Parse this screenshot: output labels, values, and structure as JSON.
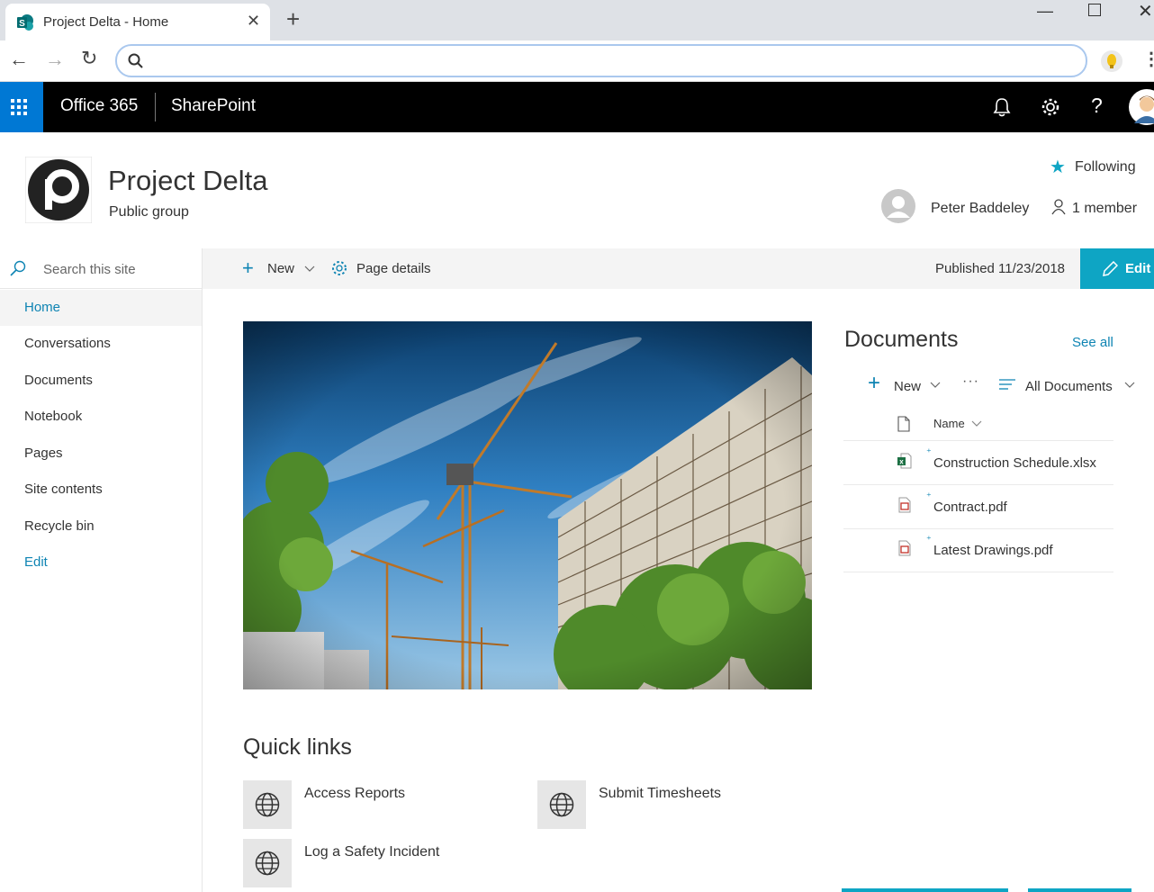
{
  "browser": {
    "tab_title": "Project Delta - Home",
    "new_tab": "+",
    "address": ""
  },
  "suite": {
    "app_name": "Office 365",
    "product": "SharePoint"
  },
  "site": {
    "title": "Project Delta",
    "subtitle": "Public group",
    "following": "Following",
    "owner": "Peter Baddeley",
    "members": "1 member"
  },
  "nav": {
    "search_placeholder": "Search this site",
    "items": [
      {
        "label": "Home"
      },
      {
        "label": "Conversations"
      },
      {
        "label": "Documents"
      },
      {
        "label": "Notebook"
      },
      {
        "label": "Pages"
      },
      {
        "label": "Site contents"
      },
      {
        "label": "Recycle bin"
      },
      {
        "label": "Edit"
      }
    ]
  },
  "command_bar": {
    "new": "New",
    "page_details": "Page details",
    "published": "Published 11/23/2018",
    "edit": "Edit"
  },
  "documents": {
    "title": "Documents",
    "see_all": "See all",
    "new": "New",
    "more": "···",
    "view": "All Documents",
    "col_name": "Name",
    "files": [
      {
        "name": "Construction Schedule.xlsx",
        "type": "xlsx"
      },
      {
        "name": "Contract.pdf",
        "type": "pdf"
      },
      {
        "name": "Latest Drawings.pdf",
        "type": "pdf"
      }
    ]
  },
  "quick_links": {
    "title": "Quick links",
    "items": [
      {
        "label": "Access Reports",
        "icon": "globe-icon"
      },
      {
        "label": "Submit Timesheets",
        "icon": "globe-icon"
      },
      {
        "label": "Log a Safety Incident",
        "icon": "globe-icon"
      }
    ]
  },
  "colors": {
    "accent": "#0ea5c4",
    "link": "#0e84b3",
    "suite_bar": "#000000",
    "waffle": "#0078d4"
  }
}
